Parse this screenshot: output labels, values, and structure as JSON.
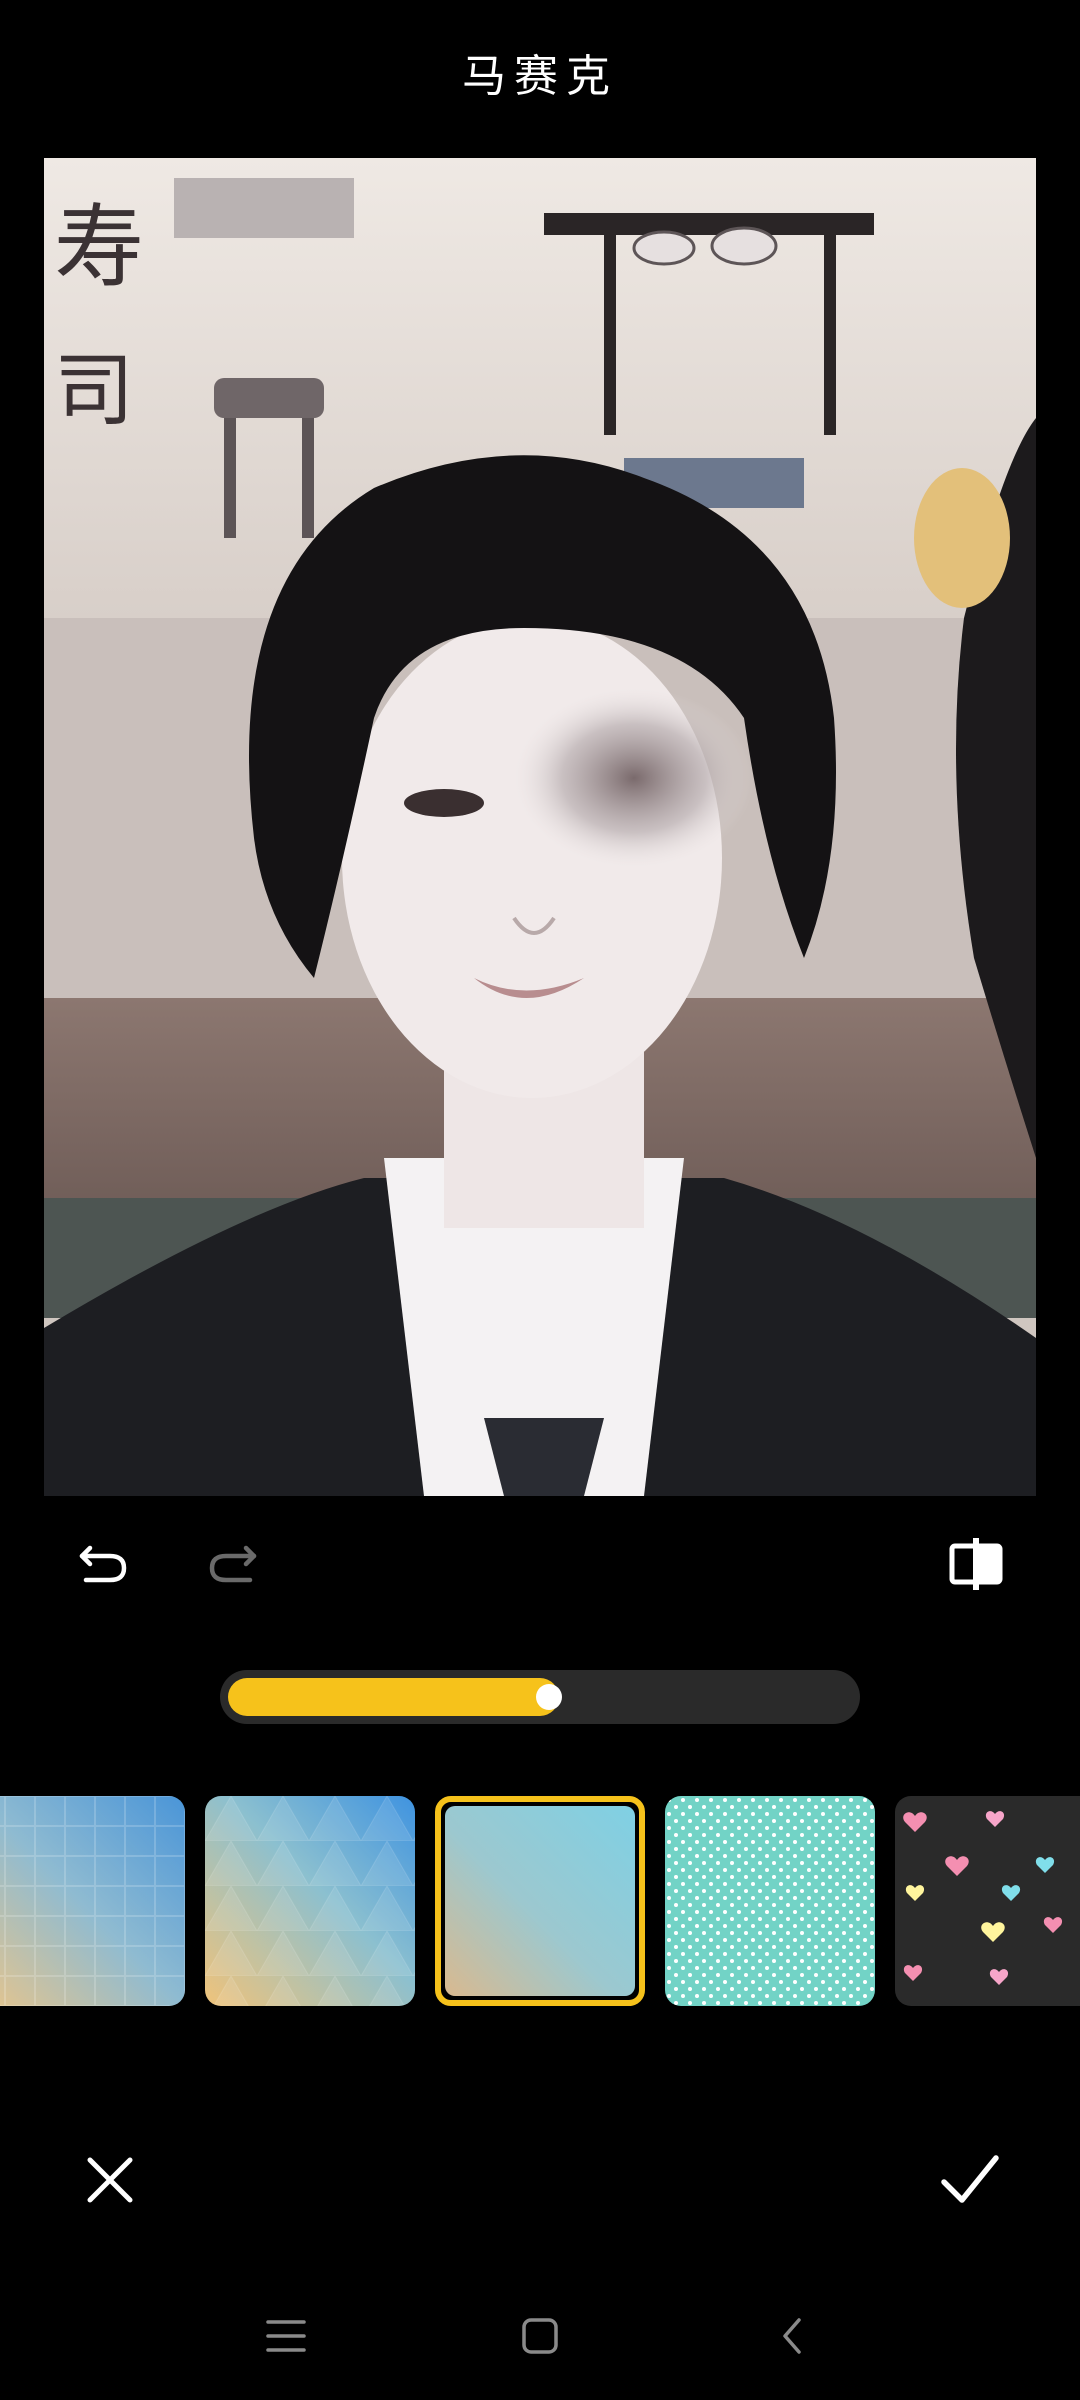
{
  "header": {
    "title": "马赛克"
  },
  "toolbar": {
    "undo_icon": "undo-icon",
    "redo_icon": "redo-icon",
    "compare_icon": "compare-icon"
  },
  "slider": {
    "value": 0.53
  },
  "patterns": {
    "items": [
      {
        "name": "pixel-grid-blue-yellow"
      },
      {
        "name": "triangle-blue-yellow"
      },
      {
        "name": "gradient-blue-tan",
        "selected": true
      },
      {
        "name": "teal-dots"
      },
      {
        "name": "hearts-dark"
      }
    ]
  },
  "actions": {
    "cancel_icon": "close-icon",
    "confirm_icon": "check-icon"
  },
  "navbar": {
    "menu_icon": "menu-icon",
    "home_icon": "home-icon",
    "back_icon": "back-icon"
  },
  "colors": {
    "accent": "#f6c21b",
    "background": "#000000",
    "track": "#2a2a2a"
  }
}
